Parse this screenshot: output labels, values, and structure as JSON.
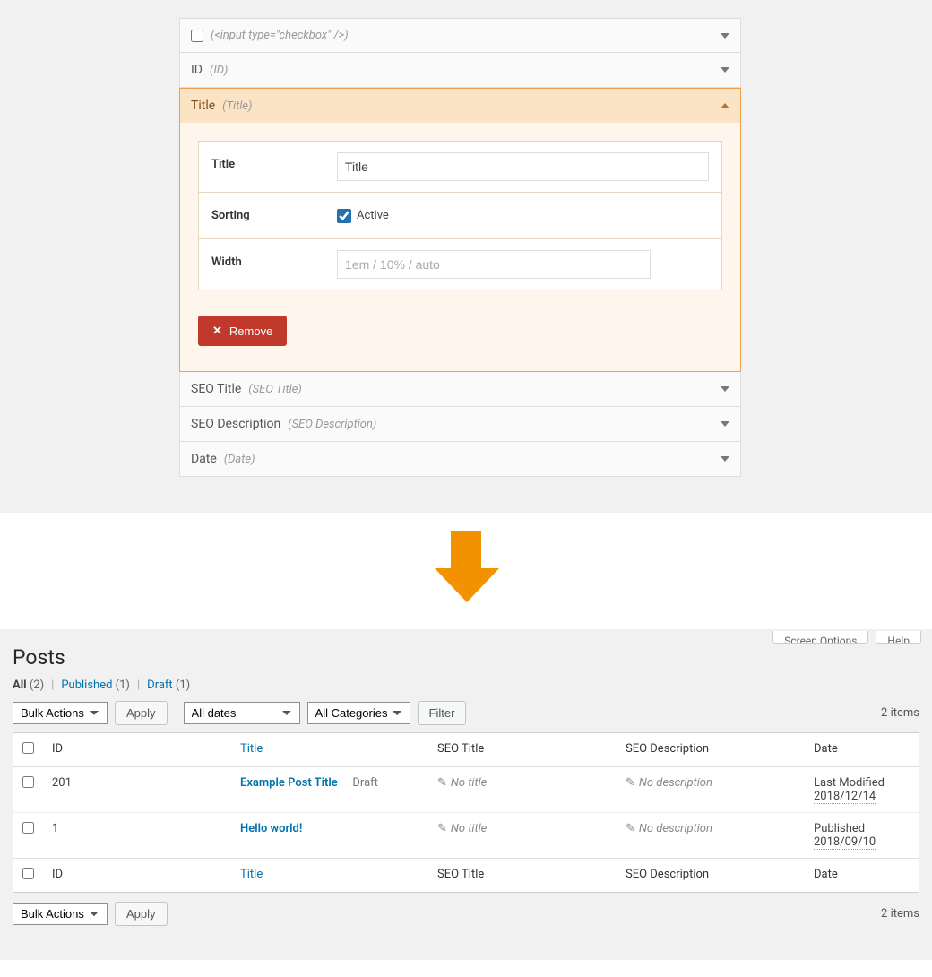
{
  "accordion": {
    "items": [
      {
        "label": "",
        "sub": "(<input type=\"checkbox\" />)",
        "has_checkbox": true
      },
      {
        "label": "ID",
        "sub": "(ID)"
      },
      {
        "label": "Title",
        "sub": "(Title)",
        "expanded": true
      },
      {
        "label": "SEO Title",
        "sub": "(SEO Title)"
      },
      {
        "label": "SEO Description",
        "sub": "(SEO Description)"
      },
      {
        "label": "Date",
        "sub": "(Date)"
      }
    ],
    "form": {
      "title_label": "Title",
      "title_value": "Title",
      "sorting_label": "Sorting",
      "sorting_checkbox_label": "Active",
      "sorting_checked": true,
      "width_label": "Width",
      "width_placeholder": "1em / 10% / auto"
    },
    "remove_label": "Remove"
  },
  "wp": {
    "screen_options": "Screen Options",
    "help": "Help",
    "page_title": "Posts",
    "filters": {
      "all": "All",
      "all_count": "(2)",
      "published": "Published",
      "published_count": "(1)",
      "draft": "Draft",
      "draft_count": "(1)"
    },
    "bulk": "Bulk Actions",
    "apply": "Apply",
    "dates": "All dates",
    "cats": "All Categories",
    "filter": "Filter",
    "items_count": "2 items",
    "headers": {
      "id": "ID",
      "title": "Title",
      "seot": "SEO Title",
      "seod": "SEO Description",
      "date": "Date"
    },
    "rows": [
      {
        "id": "201",
        "title": "Example Post Title",
        "status": " — Draft",
        "seot": "No title",
        "seod": "No description",
        "date_label": "Last Modified",
        "date": "2018/12/14"
      },
      {
        "id": "1",
        "title": "Hello world!",
        "status": "",
        "seot": "No title",
        "seod": "No description",
        "date_label": "Published",
        "date": "2018/09/10"
      }
    ]
  }
}
